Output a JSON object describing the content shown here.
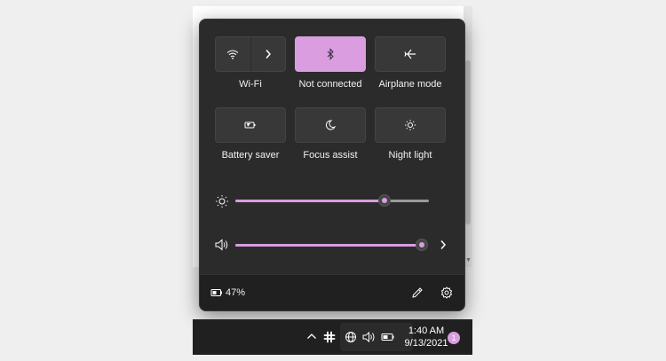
{
  "quick_settings": {
    "tiles": [
      {
        "id": "wifi",
        "label": "Wi-Fi",
        "icon": "wifi-icon",
        "active": false
      },
      {
        "id": "bluetooth",
        "label": "Not connected",
        "icon": "bluetooth-icon",
        "active": true
      },
      {
        "id": "airplane",
        "label": "Airplane mode",
        "icon": "airplane-icon",
        "active": false
      },
      {
        "id": "battery_saver",
        "label": "Battery saver",
        "icon": "battery-saver-icon",
        "active": false
      },
      {
        "id": "focus_assist",
        "label": "Focus assist",
        "icon": "moon-icon",
        "active": false
      },
      {
        "id": "night_light",
        "label": "Night light",
        "icon": "sun-icon",
        "active": false
      }
    ],
    "brightness": {
      "icon": "brightness-icon",
      "level_pct": 77
    },
    "volume": {
      "icon": "speaker-icon",
      "level_pct": 100
    },
    "footer": {
      "battery_icon": "battery-icon",
      "battery_percent": "47%",
      "edit_icon": "pencil-icon",
      "settings_icon": "gear-icon"
    }
  },
  "taskbar": {
    "tray_icons": [
      "chevron-up-icon",
      "slack-icon",
      "globe-icon",
      "speaker-icon",
      "battery-icon"
    ],
    "time": "1:40 AM",
    "date": "9/13/2021",
    "notification_count": "1"
  },
  "colors": {
    "accent": "#d99de0",
    "panel": "#2b2b2b",
    "tile": "#383838",
    "taskbar": "#202020"
  }
}
